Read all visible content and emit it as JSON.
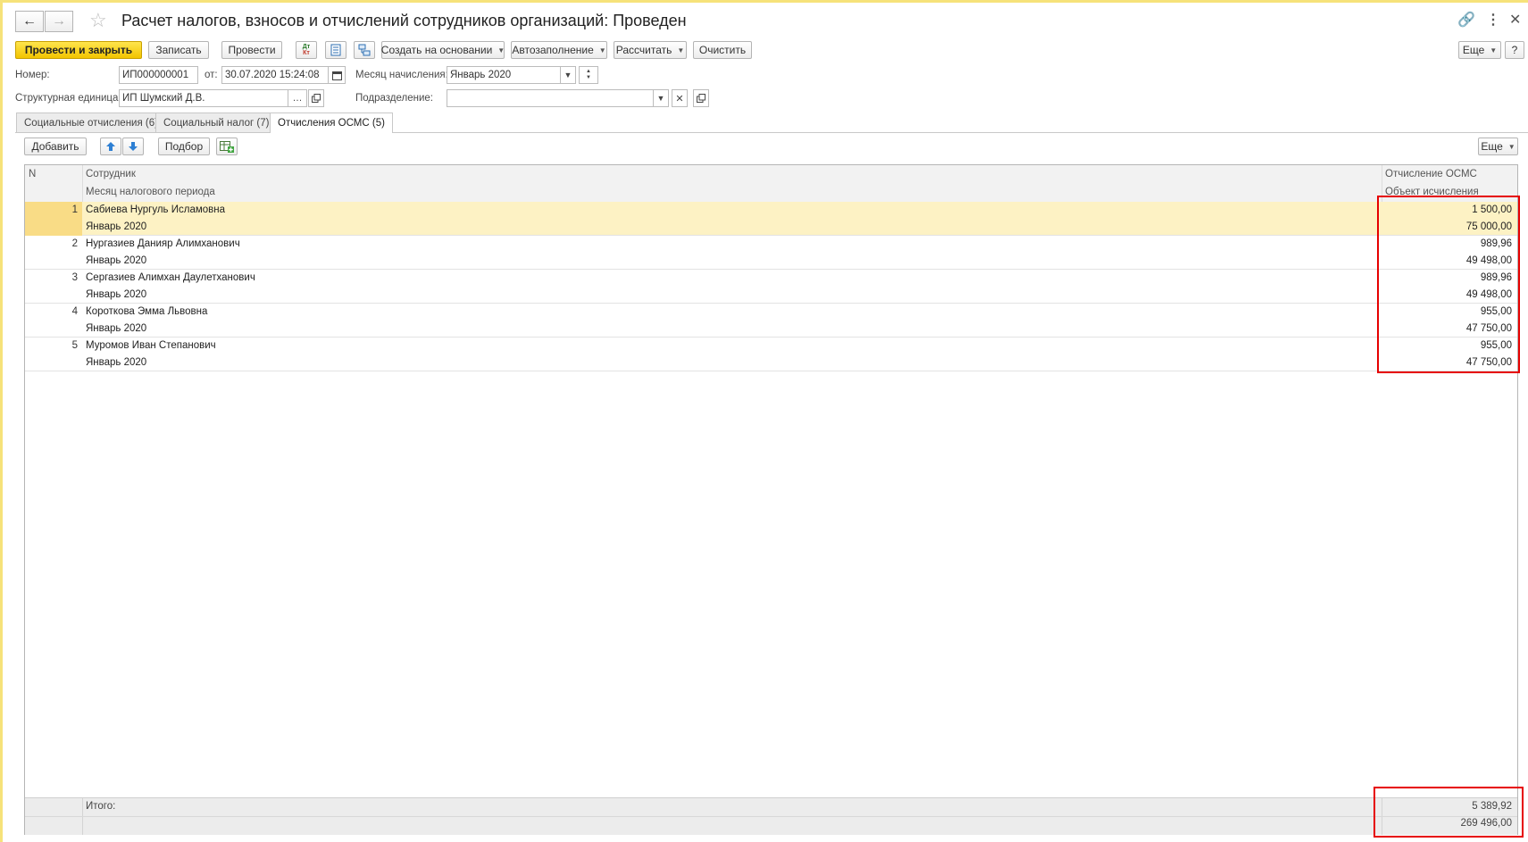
{
  "window": {
    "title": "Расчет налогов, взносов и отчислений сотрудников организаций: Проведен"
  },
  "toolbar": {
    "post_close": "Провести и закрыть",
    "save": "Записать",
    "post": "Провести",
    "create_based": "Создать на основании",
    "autofill": "Автозаполнение",
    "calculate": "Рассчитать",
    "clear": "Очистить",
    "more": "Еще",
    "help": "?"
  },
  "form": {
    "number_label": "Номер:",
    "number_value": "ИП000000001",
    "date_label": "от:",
    "date_value": "30.07.2020 15:24:08",
    "month_label": "Месяц начисления:",
    "month_value": "Январь 2020",
    "unit_label": "Структурная единица:",
    "unit_value": "ИП Шумский Д.В.",
    "division_label": "Подразделение:",
    "division_value": ""
  },
  "tabs": [
    {
      "label": "Социальные отчисления (6)"
    },
    {
      "label": "Социальный налог (7)"
    },
    {
      "label": "Отчисления ОСМС (5)"
    }
  ],
  "table_toolbar": {
    "add": "Добавить",
    "pick": "Подбор",
    "more": "Еще"
  },
  "table": {
    "headers": {
      "n": "N",
      "employee": "Сотрудник",
      "tax_month": "Месяц налогового периода",
      "osms": "Отчисление ОСМС",
      "object": "Объект исчисления"
    },
    "rows": [
      {
        "n": "1",
        "employee": "Сабиева Нургуль Исламовна",
        "month": "Январь 2020",
        "osms": "1 500,00",
        "object": "75 000,00"
      },
      {
        "n": "2",
        "employee": "Нургазиев Данияр Алимханович",
        "month": "Январь 2020",
        "osms": "989,96",
        "object": "49 498,00"
      },
      {
        "n": "3",
        "employee": "Сергазиев Алимхан Даулетханович",
        "month": "Январь 2020",
        "osms": "989,96",
        "object": "49 498,00"
      },
      {
        "n": "4",
        "employee": "Короткова Эмма Львовна",
        "month": "Январь 2020",
        "osms": "955,00",
        "object": "47 750,00"
      },
      {
        "n": "5",
        "employee": "Муромов Иван Степанович",
        "month": "Январь 2020",
        "osms": "955,00",
        "object": "47 750,00"
      }
    ],
    "footer": {
      "label": "Итого:",
      "osms_total": "5 389,92",
      "object_total": "269 496,00"
    }
  },
  "colors": {
    "accent_yellow": "#f2c400",
    "selected_row": "#fdf2c4",
    "highlight_red": "#e60000"
  }
}
